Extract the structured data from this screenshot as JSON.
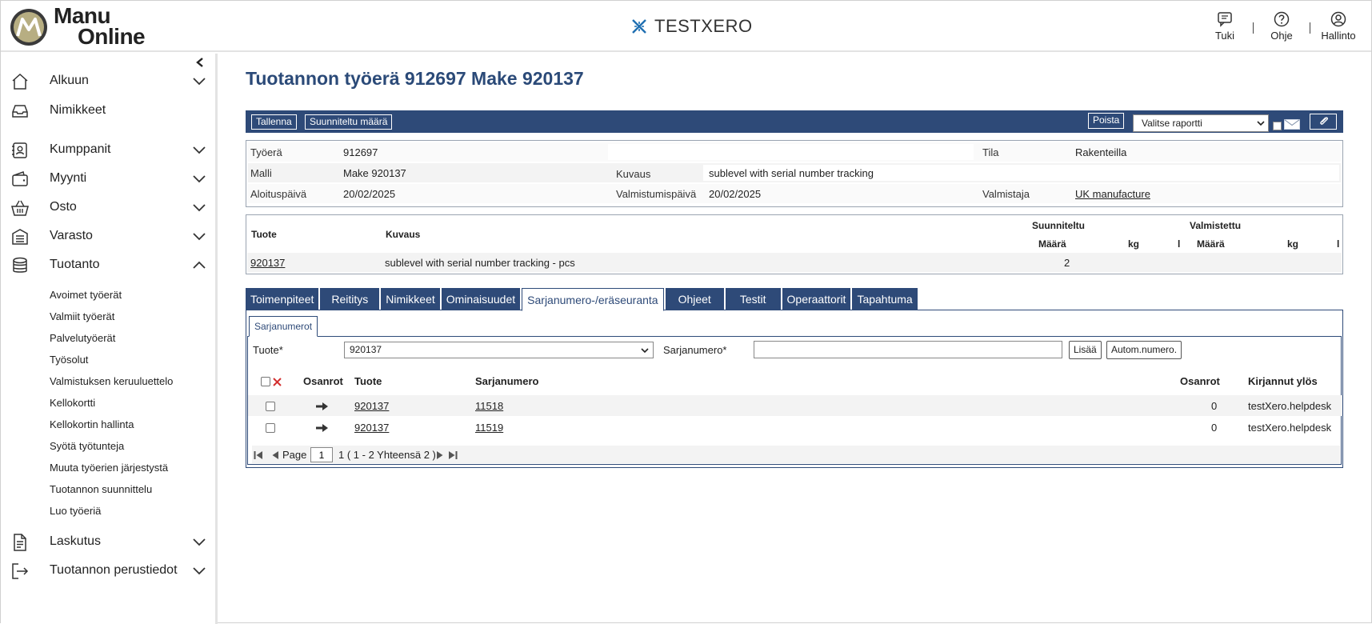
{
  "header": {
    "logo_line1": "Manu",
    "logo_line2": "Online",
    "brand_name": "TESTXERO",
    "actions": [
      {
        "label": "Tuki",
        "icon": "chat-icon"
      },
      {
        "label": "Ohje",
        "icon": "help-icon"
      },
      {
        "label": "Hallinto",
        "icon": "user-icon"
      }
    ]
  },
  "sidebar": {
    "items": [
      {
        "label": "Alkuun",
        "icon": "home-icon"
      },
      {
        "label": "Nimikkeet",
        "icon": "inbox-icon"
      },
      {
        "label": "Kumppanit",
        "icon": "contact-icon"
      },
      {
        "label": "Myynti",
        "icon": "wallet-icon"
      },
      {
        "label": "Osto",
        "icon": "basket-icon"
      },
      {
        "label": "Varasto",
        "icon": "warehouse-icon"
      },
      {
        "label": "Tuotanto",
        "icon": "database-icon"
      },
      {
        "label": "Laskutus",
        "icon": "document-icon"
      },
      {
        "label": "Tuotannon perustiedot",
        "icon": "exit-icon"
      }
    ],
    "sub_items": [
      "Avoimet työerät",
      "Valmiit työerät",
      "Palvelutyöerät",
      "Työsolut",
      "Valmistuksen keruuluettelo",
      "Kellokortti",
      "Kellokortin hallinta",
      "Syötä työtunteja",
      "Muuta työerien järjestystä",
      "Tuotannon suunnittelu",
      "Luo työeriä"
    ]
  },
  "page": {
    "title": "Tuotannon työerä 912697 Make 920137"
  },
  "toolbar": {
    "save_label": "Tallenna",
    "planned_qty_label": "Suunniteltu määrä",
    "delete_label": "Poista",
    "report_select_value": "Valitse raportti"
  },
  "info": {
    "batch_label": "Työerä",
    "batch_value": "912697",
    "status_label": "Tila",
    "status_value": "Rakenteilla",
    "model_label": "Malli",
    "model_value": "Make 920137",
    "desc_label": "Kuvaus",
    "desc_value": "sublevel with serial number tracking",
    "start_label": "Aloituspäivä",
    "start_value": "20/02/2025",
    "finish_label": "Valmistumispäivä",
    "finish_value": "20/02/2025",
    "maker_label": "Valmistaja",
    "maker_value": "UK manufacture"
  },
  "products": {
    "headers": {
      "product": "Tuote",
      "description": "Kuvaus",
      "planned": "Suunniteltu",
      "manufactured": "Valmistettu",
      "qty": "Määrä",
      "kg": "kg",
      "l": "l"
    },
    "rows": [
      {
        "product": "920137",
        "description": "sublevel with serial number tracking - pcs",
        "planned_qty": "2"
      }
    ]
  },
  "tabs": [
    "Toimenpiteet",
    "Reititys",
    "Nimikkeet",
    "Ominaisuudet",
    "Sarjanumero-/eräseuranta",
    "Ohjeet",
    "Testit",
    "Operaattorit",
    "Tapahtuma"
  ],
  "serial": {
    "subtab": "Sarjanumerot",
    "product_label": "Tuote*",
    "product_value": "920137",
    "serial_label": "Sarjanumero*",
    "serial_value": "",
    "add_label": "Lisää",
    "auto_label": "Autom.numero.",
    "columns": {
      "parts": "Osanrot",
      "product": "Tuote",
      "serial": "Sarjanumero",
      "parts2": "Osanrot",
      "logged_out": "Kirjannut ylös"
    },
    "rows": [
      {
        "product": "920137",
        "serial": "11518",
        "parts": "0",
        "user": "testXero.helpdesk"
      },
      {
        "product": "920137",
        "serial": "11519",
        "parts": "0",
        "user": "testXero.helpdesk"
      }
    ],
    "pager": {
      "page_label": "Page",
      "page_value": "1",
      "summary": "1 ( 1 - 2 Yhteensä 2 )"
    }
  },
  "colors": {
    "primary": "#2e4a78",
    "title": "#2b4a78",
    "brand_icon": "#1f6fb2",
    "delete_x": "#d32f2f"
  }
}
